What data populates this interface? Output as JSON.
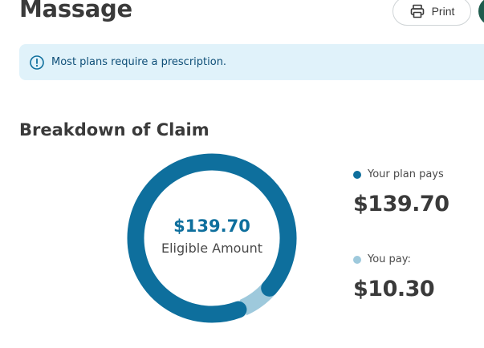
{
  "header": {
    "title": "Massage",
    "print_label": "Print",
    "print_icon": "printer-icon"
  },
  "alert": {
    "icon": "info-icon",
    "text": "Most plans require a prescription."
  },
  "breakdown": {
    "title": "Breakdown of Claim",
    "center_amount": "$139.70",
    "center_label": "Eligible Amount",
    "legend": [
      {
        "label": "Your plan pays",
        "value": "$139.70",
        "color": "#0e6f9d"
      },
      {
        "label": "You pay:",
        "value": "$10.30",
        "color": "#9ec9dc"
      }
    ]
  },
  "chart_data": {
    "type": "pie",
    "donut": true,
    "categories": [
      "Your plan pays",
      "You pay:"
    ],
    "values": [
      139.7,
      10.3
    ],
    "colors": [
      "#0e6f9d",
      "#9ec9dc"
    ]
  },
  "colors": {
    "primary": "#0e6f9d",
    "secondary": "#9ec9dc",
    "alert_bg": "#e0f2fa",
    "title_text": "#3a3a3a",
    "avatar": "#1f5c4d"
  }
}
